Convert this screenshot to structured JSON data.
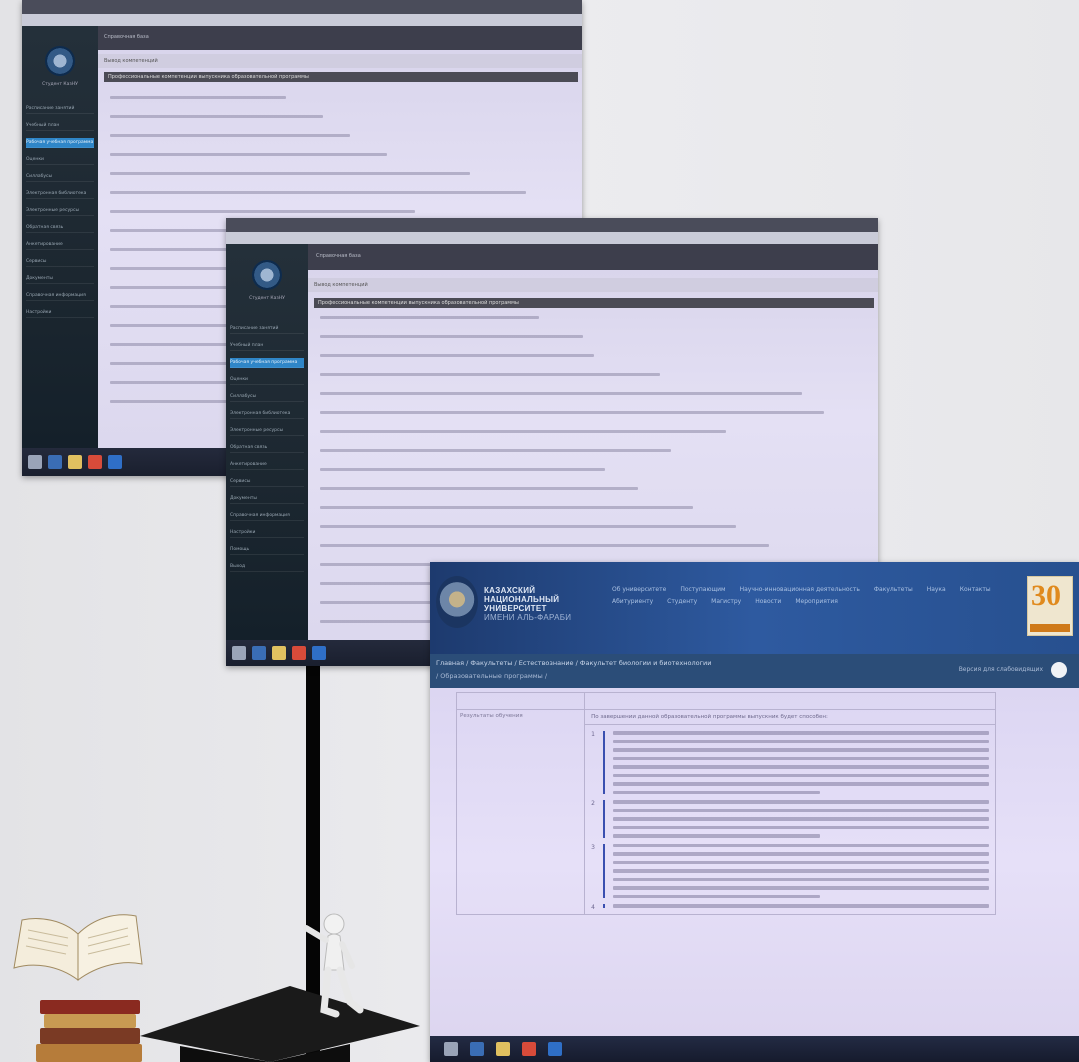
{
  "photo1": {
    "sidebar_user": "Студент КазНУ",
    "menu": [
      "Расписание занятий",
      "Учебный план",
      "Рабочая учебная программа",
      "Оценки",
      "Силлабусы",
      "Электронная библиотека",
      "Электронные ресурсы",
      "Обратная связь",
      "Анкетирование",
      "Сервисы",
      "Документы",
      "Справочная информация",
      "Настройки"
    ],
    "active_menu_index": 2,
    "top_title": "Справочная база",
    "panel_header": "Вывод компетенций",
    "dark_row": "Профессиональные компетенции выпускника образовательной программы"
  },
  "photo2": {
    "sidebar_user": "Студент КазНУ",
    "menu": [
      "Расписание занятий",
      "Учебный план",
      "Рабочая учебная программа",
      "Оценки",
      "Силлабусы",
      "Электронная библиотека",
      "Электронные ресурсы",
      "Обратная связь",
      "Анкетирование",
      "Сервисы",
      "Документы",
      "Справочная информация",
      "Настройки",
      "Помощь",
      "Выход"
    ],
    "active_menu_index": 2,
    "top_title": "Справочная база",
    "panel_header": "Вывод компетенций",
    "dark_row": "Профессиональные компетенции выпускника образовательной программы"
  },
  "photo3": {
    "university_name": [
      "КАЗАХСКИЙ",
      "НАЦИОНАЛЬНЫЙ",
      "УНИВЕРСИТЕТ",
      "ИМЕНИ АЛЬ-ФАРАБИ"
    ],
    "nav_links": [
      "Об университете",
      "Поступающим",
      "Научно-инновационная деятельность",
      "Факультеты",
      "Наука",
      "Контакты",
      "Абитуриенту",
      "Студенту",
      "Магистру",
      "Новости",
      "Мероприятия"
    ],
    "badge": "30",
    "breadcrumb": "Главная / Факультеты / Естествознание / Факультет биологии и биотехнологии",
    "breadcrumb2": "/ Образовательные программы /",
    "breadcrumb_right": "Версия для слабовидящих",
    "table_label": "Результаты обучения",
    "table_intro": "По завершении данной образовательной программы выпускник будет способен:",
    "item_numbers": [
      "1",
      "2",
      "3",
      "4"
    ]
  },
  "colors": {
    "sidebar_dark": "#1c2730",
    "sidebar_active": "#2f86c8",
    "site_header": "#2e5aa0",
    "content_lilac": "#e4e0f4",
    "badge_orange": "#e08a1e"
  }
}
